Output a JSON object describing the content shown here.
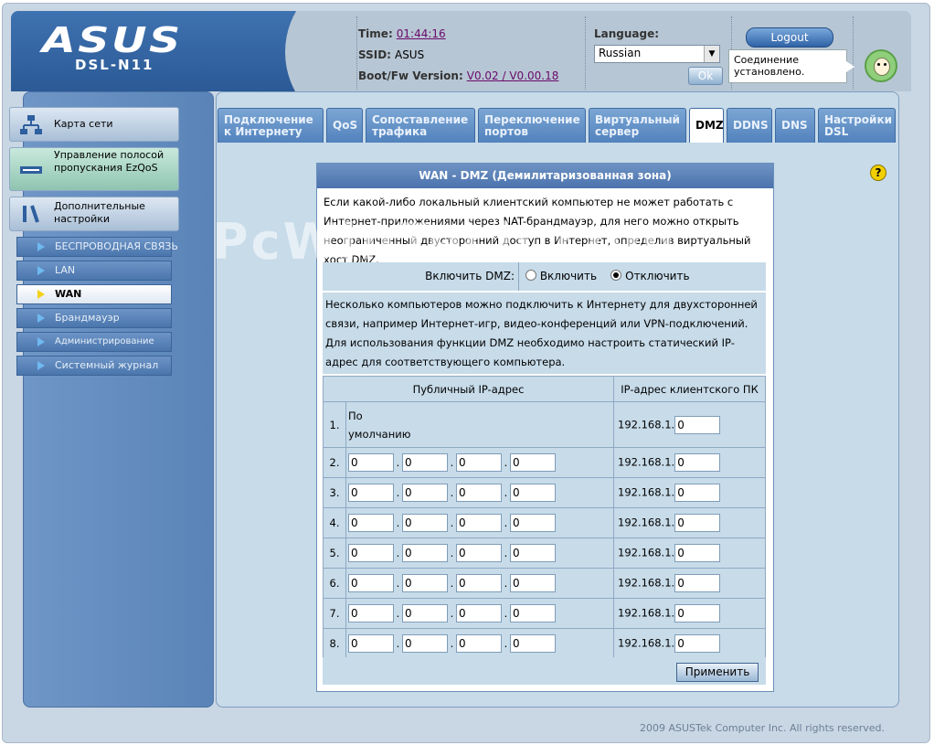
{
  "header": {
    "brand": "ASUS",
    "model": "DSL-N11",
    "time_label": "Time:",
    "time_value": "01:44:16",
    "ssid_label": "SSID:",
    "ssid_value": "ASUS",
    "fw_label": "Boot/Fw Version:",
    "fw_value": "V0.02 / V0.00.18",
    "language_label": "Language:",
    "language_value": "Russian",
    "ok_label": "Ok",
    "logout_label": "Logout",
    "status_text": "Соединение установлено."
  },
  "sidebar": {
    "main": [
      {
        "label": "Карта сети",
        "icon": "network-map-icon"
      },
      {
        "label": "Управление полосой пропускания EzQoS",
        "icon": "qos-icon"
      },
      {
        "label": "Дополнительные настройки",
        "icon": "tools-icon"
      }
    ],
    "sub": [
      {
        "label": "БЕСПРОВОДНАЯ СВЯЗЬ"
      },
      {
        "label": "LAN"
      },
      {
        "label": "WAN"
      },
      {
        "label": "Брандмауэр"
      },
      {
        "label": "Администрирование"
      },
      {
        "label": "Системный журнал"
      }
    ]
  },
  "tabs": [
    {
      "label": "Подключение к Интернету"
    },
    {
      "label": "QoS"
    },
    {
      "label": "Сопоставление трафика"
    },
    {
      "label": "Переключение портов"
    },
    {
      "label": "Виртуальный сервер"
    },
    {
      "label": "DMZ"
    },
    {
      "label": "DDNS"
    },
    {
      "label": "DNS"
    },
    {
      "label": "Настройки DSL"
    }
  ],
  "panel": {
    "title": "WAN - DMZ (Демилитаризованная зона)",
    "description": "Если какой-либо локальный клиентский компьютер не может работать с Интернет-приложениями через NAT-брандмауэр, для него можно открыть неограниченный двусторонний доступ в Интернет, определив виртуальный хост DMZ.",
    "enable_label": "Включить DMZ:",
    "option_on": "Включить",
    "option_off": "Отключить",
    "selected": "Отключить",
    "note": "Несколько компьютеров можно подключить к Интернету для двухсторонней связи, например Интернет-игр, видео-конференций или VPN-подключений.  Для использования функции DMZ необходимо настроить статический IP-адрес для соответствующего компьютера.",
    "col_public": "Публичный IP-адрес",
    "col_client": "IP-адрес клиентского ПК",
    "default_label_1": "По",
    "default_label_2": "умолчанию",
    "ip_prefix": "192.168.1.",
    "rows": [
      {
        "num": "1.",
        "client": "0"
      },
      {
        "num": "2.",
        "pub": [
          "0",
          "0",
          "0",
          "0"
        ],
        "client": "0"
      },
      {
        "num": "3.",
        "pub": [
          "0",
          "0",
          "0",
          "0"
        ],
        "client": "0"
      },
      {
        "num": "4.",
        "pub": [
          "0",
          "0",
          "0",
          "0"
        ],
        "client": "0"
      },
      {
        "num": "5.",
        "pub": [
          "0",
          "0",
          "0",
          "0"
        ],
        "client": "0"
      },
      {
        "num": "6.",
        "pub": [
          "0",
          "0",
          "0",
          "0"
        ],
        "client": "0"
      },
      {
        "num": "7.",
        "pub": [
          "0",
          "0",
          "0",
          "0"
        ],
        "client": "0"
      },
      {
        "num": "8.",
        "pub": [
          "0",
          "0",
          "0",
          "0"
        ],
        "client": "0"
      }
    ],
    "apply_label": "Применить"
  },
  "footer": "2009 ASUSTek Computer Inc. All rights reserved.",
  "watermark": "PcWinTech.com",
  "colors": {
    "accent": "#4a72ad",
    "panel_bg": "#c7dbe9",
    "sidebar": "#5a84b8"
  }
}
